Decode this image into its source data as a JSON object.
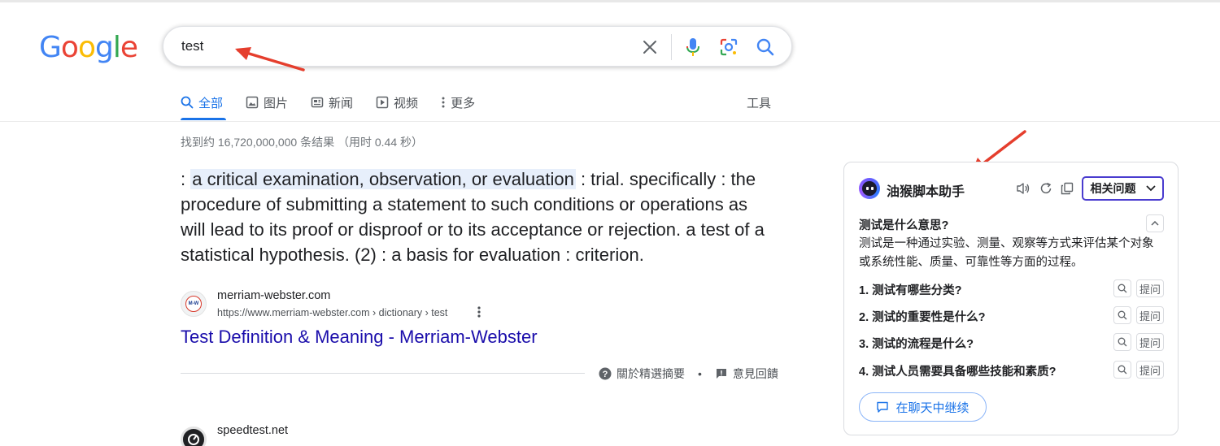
{
  "logo": {
    "letters": [
      "G",
      "o",
      "o",
      "g",
      "l",
      "e"
    ],
    "colors": [
      "#4285F4",
      "#EA4335",
      "#FBBC05",
      "#4285F4",
      "#34A853",
      "#EA4335"
    ]
  },
  "search": {
    "value": "test",
    "icons": {
      "clear": "close-icon",
      "voice": "microphone-icon",
      "lens": "camera-lens-icon",
      "submit": "search-icon"
    }
  },
  "tabs": [
    {
      "label": "全部",
      "icon": "search-icon",
      "active": true
    },
    {
      "label": "图片",
      "icon": "image-icon"
    },
    {
      "label": "新闻",
      "icon": "news-icon"
    },
    {
      "label": "视频",
      "icon": "play-icon"
    },
    {
      "label": "更多",
      "icon": "more-vert-icon"
    }
  ],
  "tools_label": "工具",
  "stats": "找到约 16,720,000,000 条结果 （用时 0.44 秒）",
  "snippet": {
    "prefix": ": ",
    "highlight": "a critical examination, observation, or evaluation",
    "rest": " : trial. specifically : the procedure of submitting a statement to such conditions or operations as will lead to its proof or disproof or to its acceptance or rejection. a test of a statistical hypothesis. (2) : a basis for evaluation : criterion."
  },
  "result1": {
    "site": "merriam-webster.com",
    "url": "https://www.merriam-webster.com › dictionary › test",
    "favicon_text": "M-W",
    "title": "Test Definition & Meaning - Merriam-Webster"
  },
  "feedback": {
    "about": "關於精選摘要",
    "separator": "•",
    "feedback": "意見回饋"
  },
  "result2": {
    "site": "speedtest.net"
  },
  "assistant": {
    "title": "油猴脚本助手",
    "related_button": "相关问题",
    "question": "测试是什么意思?",
    "answer": "测试是一种通过实验、测量、观察等方式来评估某个对象或系统性能、质量、可靠性等方面的过程。",
    "related": [
      "1. 测试有哪些分类?",
      "2. 测试的重要性是什么?",
      "3. 测试的流程是什么?",
      "4. 测试人员需要具备哪些技能和素质?"
    ],
    "ask_label": "提问",
    "continue_label": "在聊天中继续",
    "accent": "#4a3ccf"
  },
  "annotation_color": "#e53e2d"
}
